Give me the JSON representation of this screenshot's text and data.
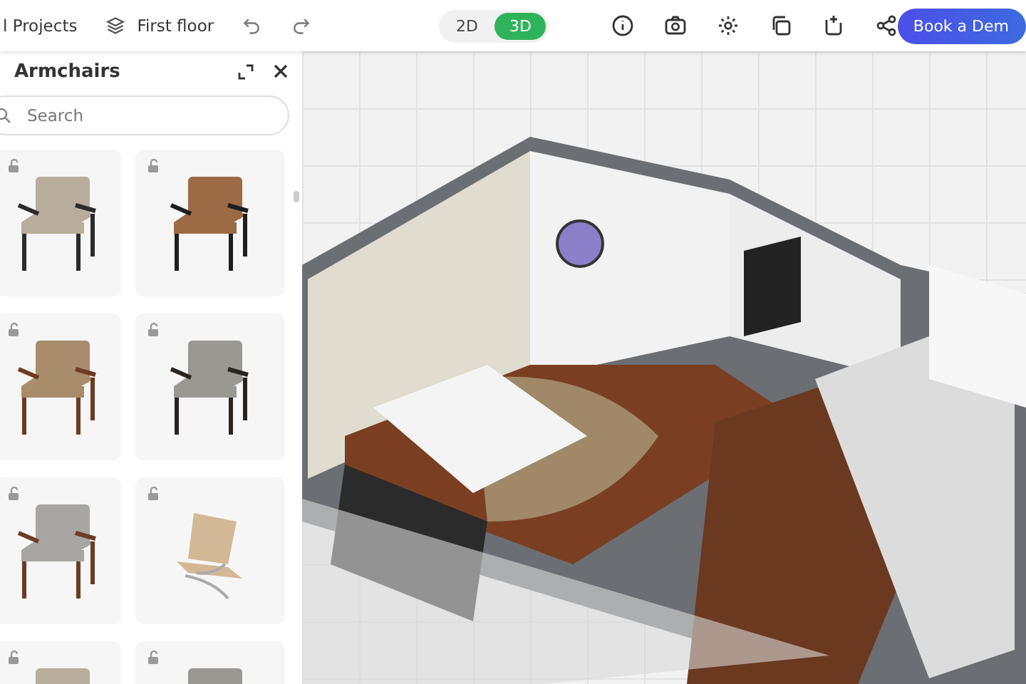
{
  "toolbar": {
    "projects_link": "l Projects",
    "floor": "First floor",
    "view_modes": [
      {
        "label": "2D",
        "selected": false
      },
      {
        "label": "3D",
        "selected": true
      }
    ],
    "cta": "Book a Dem"
  },
  "panel": {
    "title": "Armchairs",
    "search": {
      "placeholder": "Search"
    },
    "items": [
      {
        "kind": "padded"
      },
      {
        "kind": "sling"
      },
      {
        "kind": "lattice"
      },
      {
        "kind": "box"
      },
      {
        "kind": "tub"
      },
      {
        "kind": "barcelona"
      },
      {
        "kind": "padded"
      },
      {
        "kind": "box"
      }
    ]
  }
}
